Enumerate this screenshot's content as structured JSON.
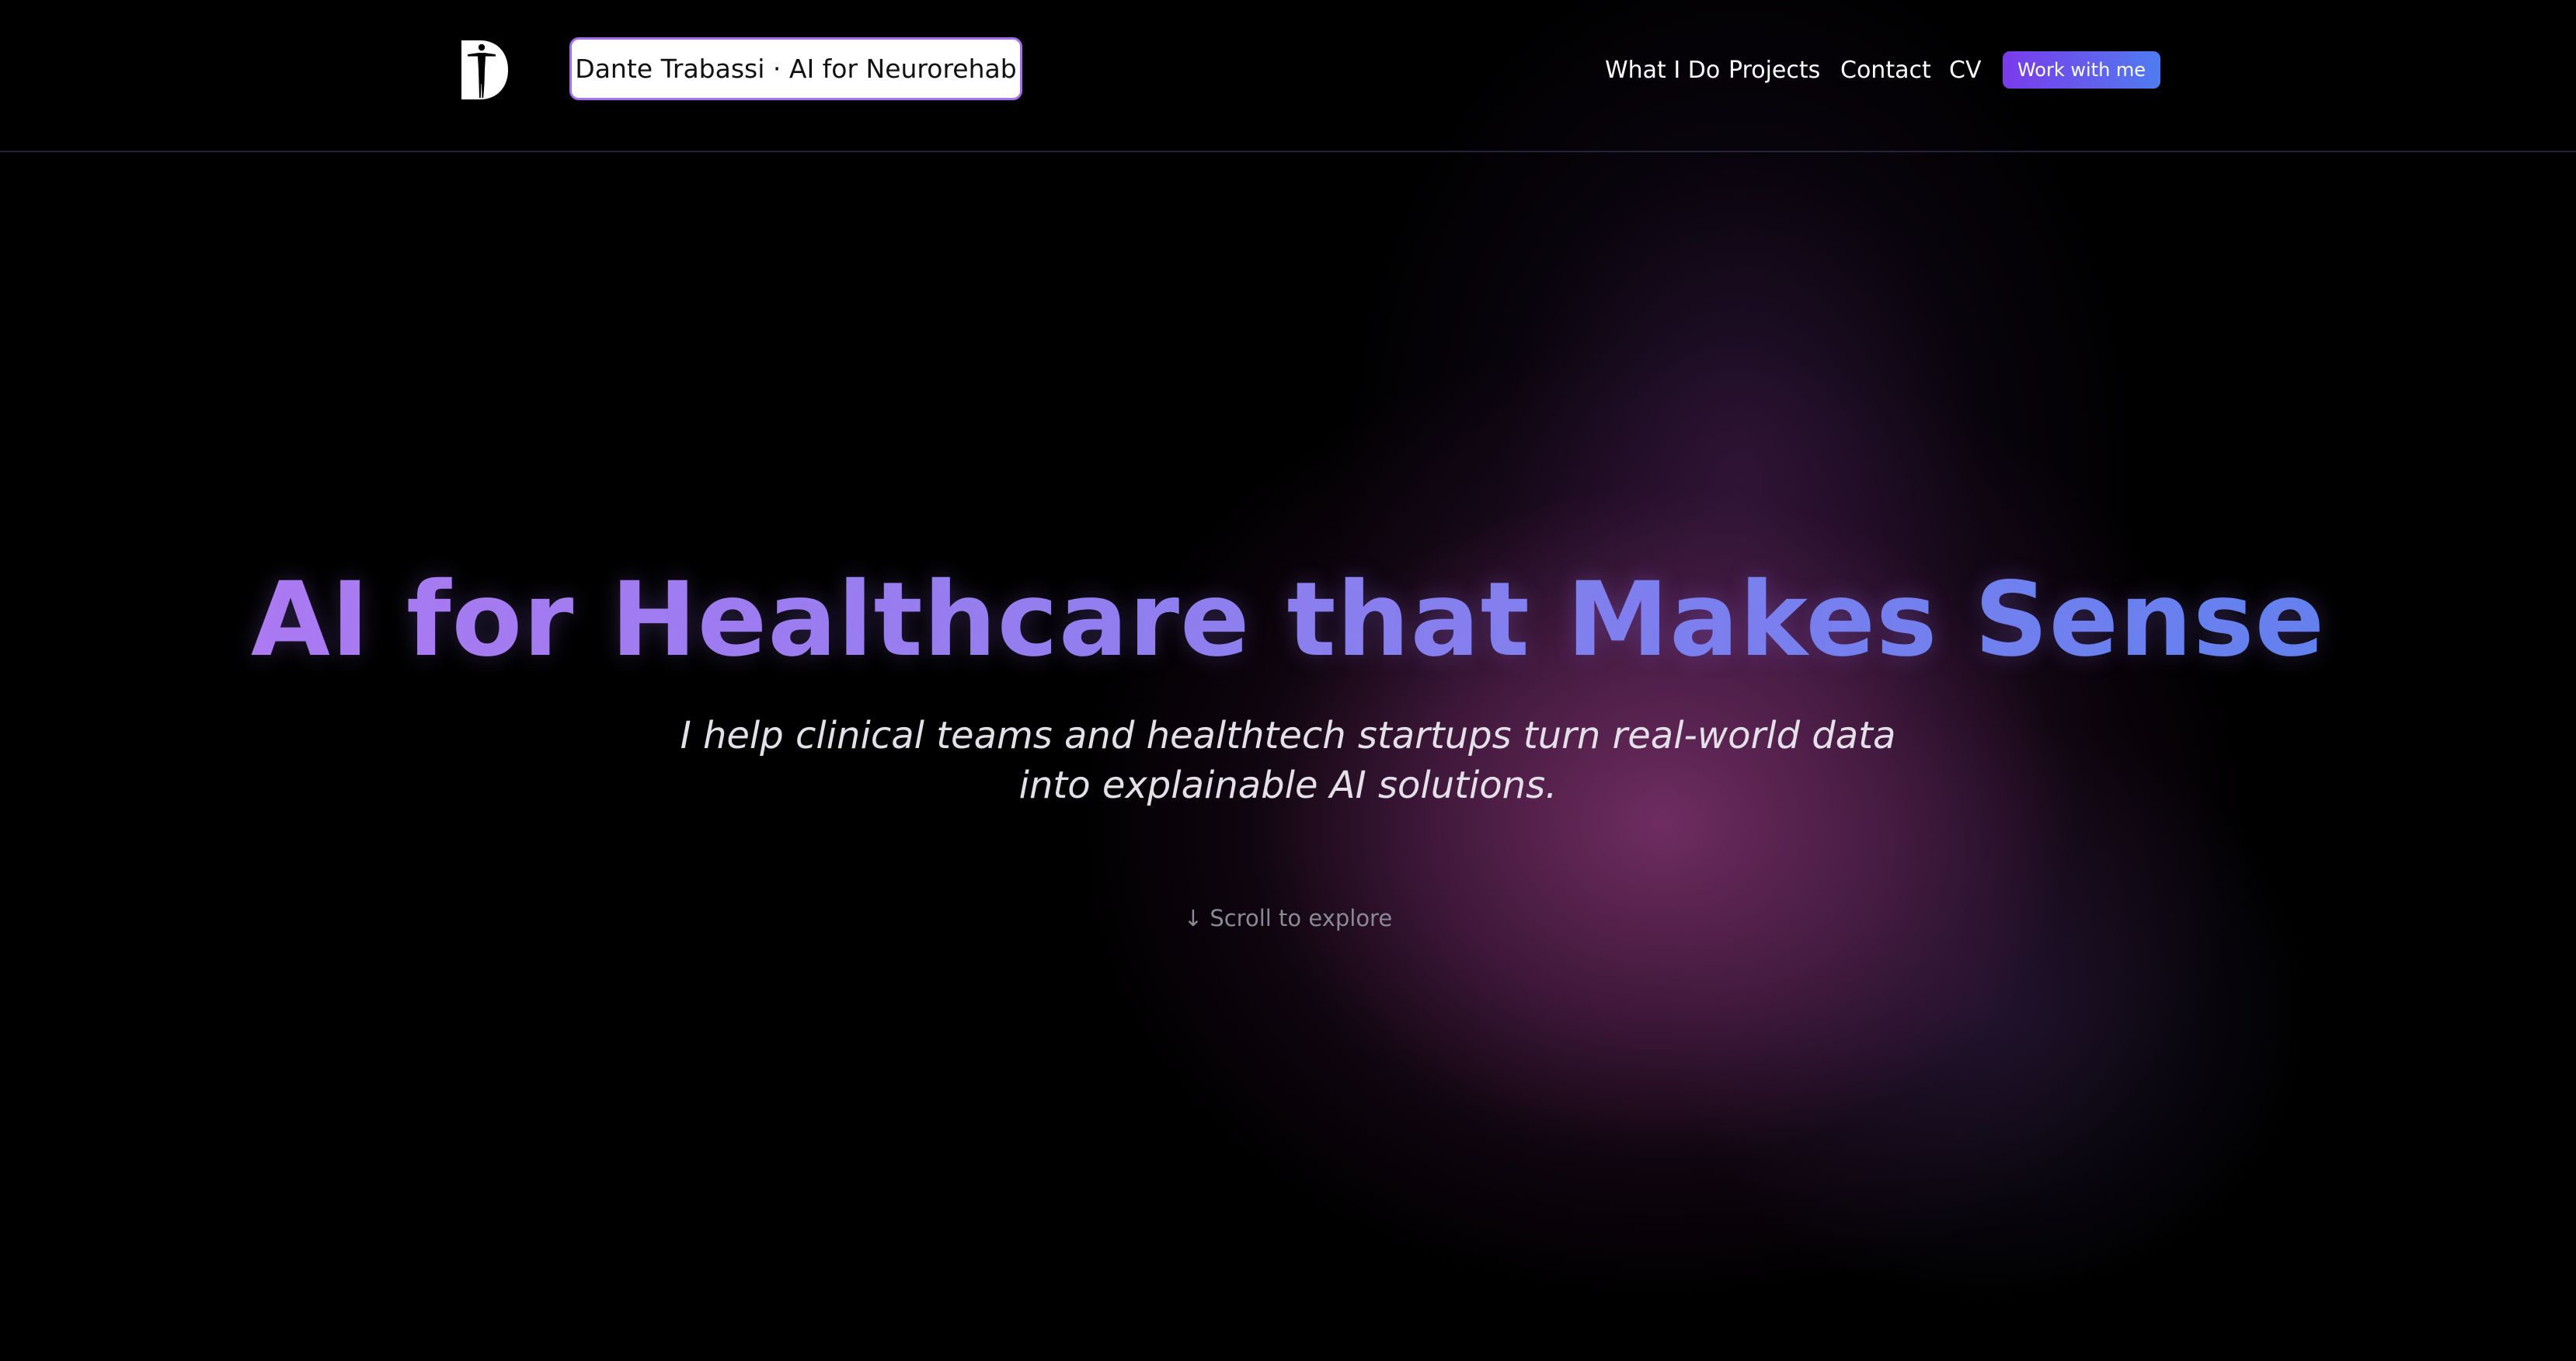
{
  "header": {
    "logo_icon": "person-silhouette-d-logo-icon",
    "brand_label": "Dante Trabassi · AI for Neurorehab",
    "nav": {
      "what_i_do": "What I Do",
      "projects": "Projects",
      "contact": "Contact",
      "cv": "CV"
    },
    "cta_label": "Work with me"
  },
  "hero": {
    "title": "AI for Healthcare that Makes Sense",
    "subtitle_line1": "I help clinical teams and healthtech startups turn real-world data",
    "subtitle_line2": "into explainable AI solutions.",
    "scroll_hint": "↓ Scroll to explore"
  },
  "colors": {
    "background": "#000000",
    "accent_purple": "#7a3bea",
    "accent_blue": "#4f7cf0",
    "title_gradient_start": "#b07cf2",
    "title_gradient_end": "#5c84ee",
    "glow": "#782f68"
  }
}
